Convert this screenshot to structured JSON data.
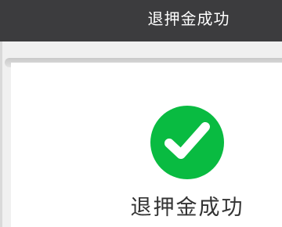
{
  "header": {
    "title": "退押金成功"
  },
  "result": {
    "icon": "checkmark-circle-icon",
    "message": "退押金成功",
    "color": "#09bb41"
  }
}
